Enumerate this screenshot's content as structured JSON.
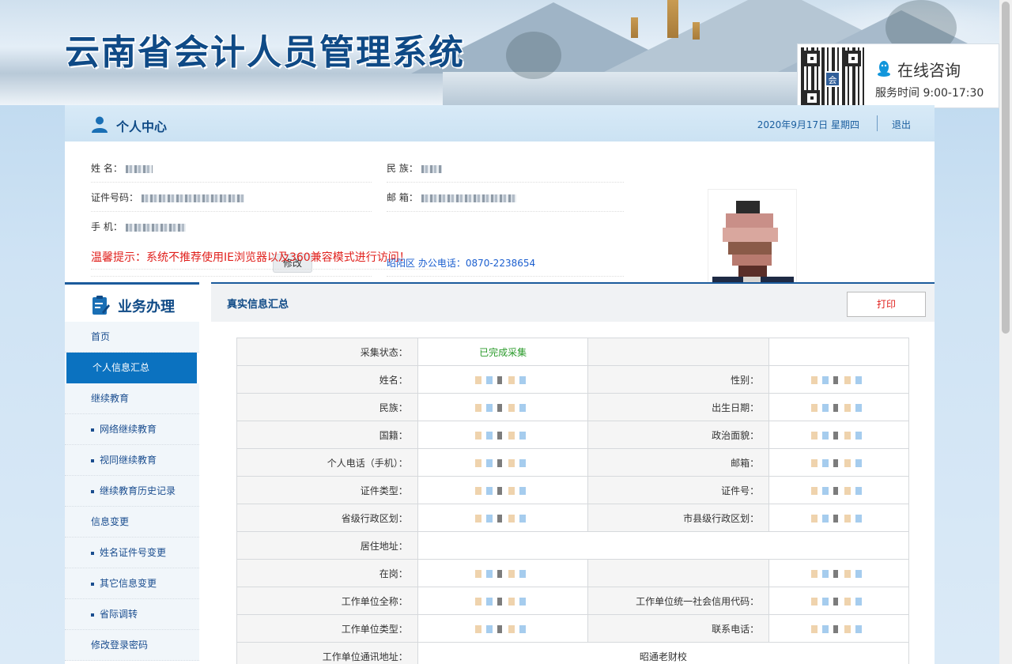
{
  "header": {
    "site_title": "云南省会计人员管理系统",
    "consult_title": "在线咨询",
    "service_time": "服务时间 9:00-17:30",
    "qr_logo": "会"
  },
  "user_center": {
    "title": "个人中心",
    "date": "2020年9月17日 星期四",
    "logout": "退出"
  },
  "profile": {
    "name_label": "姓 名：",
    "ethnic_label": "民 族：",
    "id_label": "证件号码：",
    "email_label": "邮 箱：",
    "phone_label": "手 机：",
    "edit_button": "修改",
    "office_phone": "昭阳区 办公电话：0870-2238654",
    "warning": "温馨提示：系统不推荐使用IE浏览器以及360兼容模式进行访问！"
  },
  "sidebar": {
    "title": "业务办理",
    "items": [
      {
        "label": "首页",
        "sub": false,
        "active": false
      },
      {
        "label": "个人信息汇总",
        "sub": false,
        "active": true
      },
      {
        "label": "继续教育",
        "sub": false,
        "active": false
      },
      {
        "label": "网络继续教育",
        "sub": true,
        "active": false
      },
      {
        "label": "视同继续教育",
        "sub": true,
        "active": false
      },
      {
        "label": "继续教育历史记录",
        "sub": true,
        "active": false
      },
      {
        "label": "信息变更",
        "sub": false,
        "active": false
      },
      {
        "label": "姓名证件号变更",
        "sub": true,
        "active": false
      },
      {
        "label": "其它信息变更",
        "sub": true,
        "active": false
      },
      {
        "label": "省际调转",
        "sub": true,
        "active": false
      },
      {
        "label": "修改登录密码",
        "sub": false,
        "active": false
      }
    ]
  },
  "content": {
    "title": "真实信息汇总",
    "print_button": "打印",
    "rows": [
      {
        "l1": "采集状态：",
        "v1": "已完成采集",
        "l2": "",
        "v2": ""
      },
      {
        "l1": "姓名：",
        "v1": "",
        "l2": "性别：",
        "v2": ""
      },
      {
        "l1": "民族：",
        "v1": "",
        "l2": "出生日期：",
        "v2": ""
      },
      {
        "l1": "国籍：",
        "v1": "",
        "l2": "政治面貌：",
        "v2": ""
      },
      {
        "l1": "个人电话（手机）：",
        "v1": "",
        "l2": "邮箱：",
        "v2": ""
      },
      {
        "l1": "证件类型：",
        "v1": "",
        "l2": "证件号：",
        "v2": ""
      },
      {
        "l1": "省级行政区划：",
        "v1": "",
        "l2": "市县级行政区划：",
        "v2": ""
      },
      {
        "l1": "居住地址：",
        "v1": "",
        "l2": null,
        "v2": null
      },
      {
        "l1": "在岗：",
        "v1": "",
        "l2": "",
        "v2": ""
      },
      {
        "l1": "工作单位全称：",
        "v1": "",
        "l2": "工作单位统一社会信用代码：",
        "v2": ""
      },
      {
        "l1": "工作单位类型：",
        "v1": "",
        "l2": "联系电话：",
        "v2": ""
      },
      {
        "l1": "工作单位通讯地址：",
        "v1": "昭通老财校",
        "l2": null,
        "v2": null
      }
    ]
  },
  "colors": {
    "brand_blue": "#0f4a86",
    "active_menu": "#0b72c0",
    "warning_red": "#e0201c",
    "done_green": "#2a9a2a"
  }
}
